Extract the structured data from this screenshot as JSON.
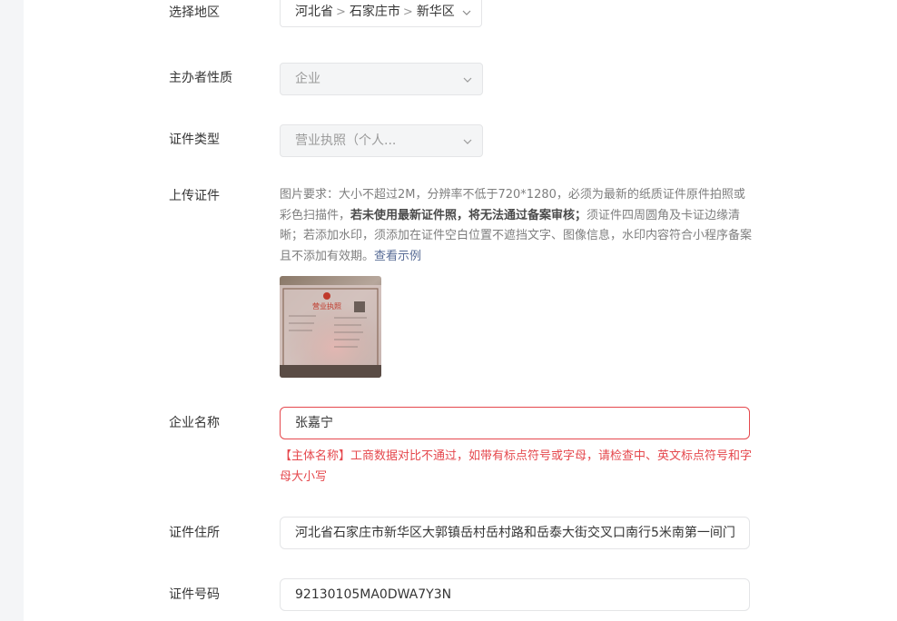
{
  "region": {
    "label": "选择地区",
    "province": "河北省",
    "city": "石家庄市",
    "district": "新华区",
    "separator": ">"
  },
  "organizer_type": {
    "label": "主办者性质",
    "value": "企业"
  },
  "certificate_type": {
    "label": "证件类型",
    "value": "营业执照（个人..."
  },
  "upload": {
    "label": "上传证件",
    "req_intro": "图片要求：大小不超过2M，分辨率不低于720*1280，必须为最新的纸质证件原件拍照或彩色扫描件，",
    "req_bold": "若未使用最新证件照，将无法通过备案审核；",
    "req_rest": "须证件四周圆角及卡证边缘清晰；若添加水印，须添加在证件空白位置不遮挡文字、图像信息，水印内容符合小程序备案且不添加有效期。",
    "example_link": "查看示例",
    "thumb_title": "营业执照"
  },
  "company_name": {
    "label": "企业名称",
    "value": "张嘉宁",
    "error": "【主体名称】工商数据对比不通过，如带有标点符号或字母，请检查中、英文标点符号和字母大小写"
  },
  "address": {
    "label": "证件住所",
    "value": "河北省石家庄市新华区大郭镇岳村岳村路和岳泰大街交叉口南行5米南第一间门"
  },
  "cert_number": {
    "label": "证件号码",
    "value": "92130105MA0DWA7Y3N"
  },
  "colors": {
    "error": "#e5484d",
    "link": "#576b95",
    "disabled_bg": "#f4f5f6"
  }
}
